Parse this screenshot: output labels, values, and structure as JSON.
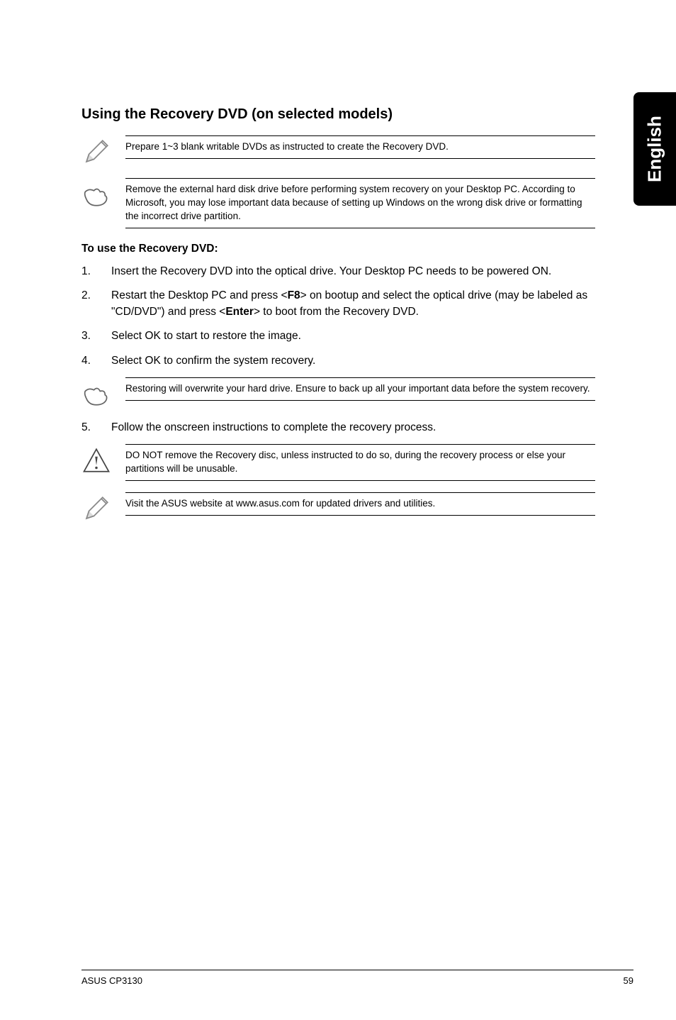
{
  "sideTab": "English",
  "sectionTitle": "Using the Recovery DVD (on selected models)",
  "notes": {
    "prepare": "Prepare 1~3 blank writable DVDs as instructed to create the Recovery DVD.",
    "removeDisk": "Remove the external hard disk drive before performing system recovery on your Desktop PC. According to Microsoft, you may lose important data because of setting up Windows on the wrong disk drive or formatting the incorrect drive partition.",
    "restoring": "Restoring will overwrite your hard drive. Ensure to back up all your important data before the system recovery.",
    "doNotRemove": "DO NOT remove the Recovery disc, unless instructed to do so, during the recovery process or else your partitions will be unusable.",
    "visitSite": "Visit the ASUS website at www.asus.com for updated drivers and utilities."
  },
  "subHeading": "To use the Recovery DVD:",
  "steps": {
    "s1": {
      "num": "1.",
      "txt": "Insert the Recovery DVD into the optical drive. Your Desktop PC needs to be powered ON."
    },
    "s2": {
      "num": "2.",
      "txtPrefix": "Restart the Desktop PC and press <",
      "f8": "F8",
      "txtMid": "> on bootup and select the optical drive (may be labeled as \"CD/DVD\") and press <",
      "enter": "Enter",
      "txtSuffix": "> to boot from the Recovery DVD."
    },
    "s3": {
      "num": "3.",
      "txt": "Select OK to start to restore the image."
    },
    "s4": {
      "num": "4.",
      "txt": "Select OK to confirm the system recovery."
    },
    "s5": {
      "num": "5.",
      "txt": "Follow the onscreen instructions to complete the recovery process."
    }
  },
  "footer": {
    "left": "ASUS CP3130",
    "right": "59"
  }
}
